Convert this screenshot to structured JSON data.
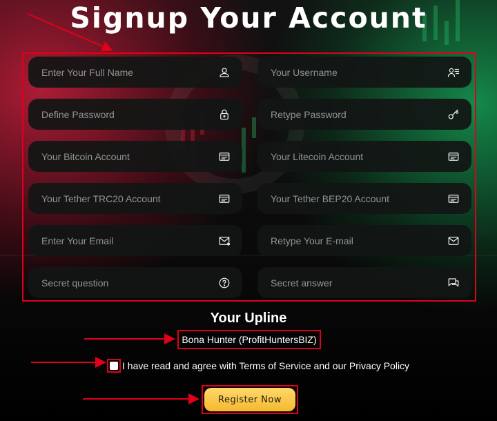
{
  "page": {
    "title": "Signup Your Account"
  },
  "form": {
    "fields": [
      {
        "placeholder": "Enter Your Full Name",
        "icon": "user-icon"
      },
      {
        "placeholder": "Your Username",
        "icon": "user-list-icon"
      },
      {
        "placeholder": "Define Password",
        "icon": "lock-icon"
      },
      {
        "placeholder": "Retype Password",
        "icon": "key-icon"
      },
      {
        "placeholder": "Your Bitcoin Account",
        "icon": "wallet-card-icon"
      },
      {
        "placeholder": "Your Litecoin Account",
        "icon": "wallet-card-icon"
      },
      {
        "placeholder": "Your Tether TRC20 Account",
        "icon": "wallet-card-icon"
      },
      {
        "placeholder": "Your Tether BEP20 Account",
        "icon": "wallet-card-icon"
      },
      {
        "placeholder": "Enter Your Email",
        "icon": "mail-dot-icon"
      },
      {
        "placeholder": "Retype Your E-mail",
        "icon": "mail-icon"
      },
      {
        "placeholder": "Secret question",
        "icon": "question-circle-icon"
      },
      {
        "placeholder": "Secret answer",
        "icon": "chat-icon"
      }
    ]
  },
  "upline": {
    "title": "Your Upline",
    "value": "Bona Hunter (ProfitHuntersBIZ)"
  },
  "agreement": {
    "text": "I have read and agree with Terms of Service and our Privacy Policy",
    "checked": true
  },
  "register": {
    "label": "Register Now"
  },
  "colors": {
    "annotation_red": "#e0001b",
    "button_yellow": "#f5b82e",
    "field_bg": "#121614"
  }
}
